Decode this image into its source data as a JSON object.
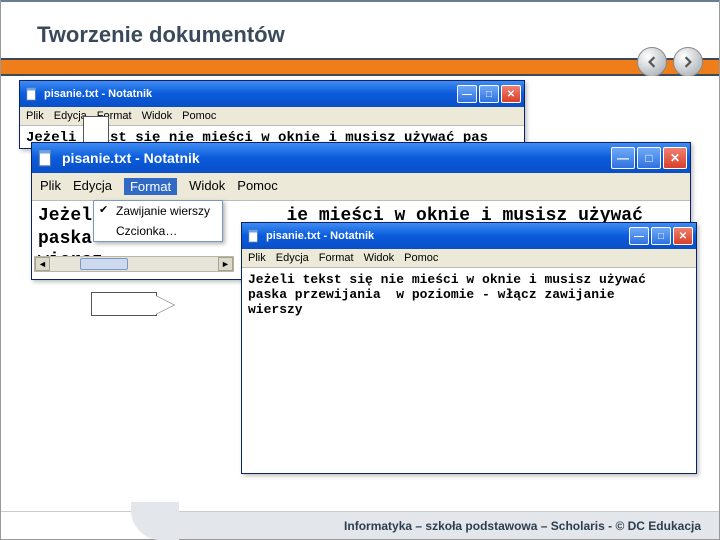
{
  "slide": {
    "title": "Tworzenie dokumentów"
  },
  "menus": {
    "items": [
      "Plik",
      "Edycja",
      "Format",
      "Widok",
      "Pomoc"
    ],
    "items_short": [
      "Plik",
      "Edycja",
      "Format",
      "Widok",
      "Pomoc"
    ]
  },
  "dropdown": {
    "wrap": "Zawijanie wierszy",
    "font": "Czcionka…"
  },
  "win1": {
    "title": "pisanie.txt - Notatnik",
    "body": "Jeżeli tekst się nie mieści w oknie i musisz używać pas"
  },
  "win2": {
    "title": "pisanie.txt - Notatnik",
    "line1": "Jeżeli                 ie mieści w oknie i musisz używać",
    "line2": "paska ",
    "line3": "wiersz"
  },
  "win3": {
    "title": "pisanie.txt - Notatnik",
    "body": "Jeżeli tekst się nie mieści w oknie i musisz używać\npaska przewijania  w poziomie - włącz zawijanie\nwierszy"
  },
  "footer": {
    "text": "Informatyka – szkoła podstawowa – Scholaris - © DC Edukacja"
  }
}
